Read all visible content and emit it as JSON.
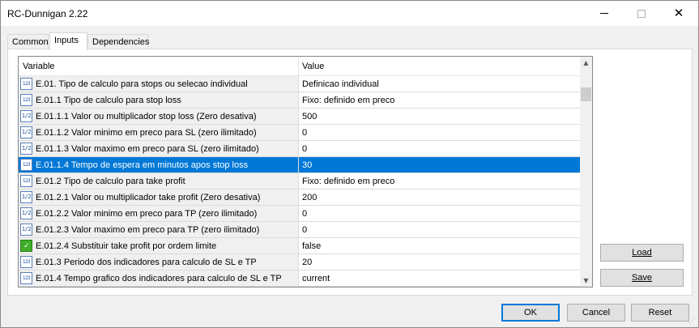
{
  "window": {
    "title": "RC-Dunnigan 2.22"
  },
  "tabs": [
    {
      "label": "Common"
    },
    {
      "label": "Inputs"
    },
    {
      "label": "Dependencies"
    }
  ],
  "grid": {
    "headers": {
      "variable": "Variable",
      "value": "Value"
    },
    "rows": [
      {
        "icon": "123",
        "label": "E.01. Tipo de calculo para stops ou selecao individual",
        "value": "Definicao individual"
      },
      {
        "icon": "123",
        "label": "E.01.1 Tipo de calculo para stop loss",
        "value": "Fixo: definido em preco"
      },
      {
        "icon": "1/2",
        "label": "E.01.1.1 Valor ou multiplicador stop loss (Zero desativa)",
        "value": "500"
      },
      {
        "icon": "1/2",
        "label": "E.01.1.2 Valor minimo em preco para SL (zero ilimitado)",
        "value": "0"
      },
      {
        "icon": "1/2",
        "label": "E.01.1.3 Valor maximo em preco para SL (zero ilimitado)",
        "value": "0"
      },
      {
        "icon": "123",
        "label": "E.01.1.4 Tempo de espera em minutos apos stop loss",
        "value": "30",
        "selected": true
      },
      {
        "icon": "123",
        "label": "E.01.2 Tipo de calculo para take profit",
        "value": "Fixo: definido em preco"
      },
      {
        "icon": "1/2",
        "label": "E.01.2.1 Valor ou multiplicador take profit (Zero desativa)",
        "value": "200"
      },
      {
        "icon": "1/2",
        "label": "E.01.2.2 Valor minimo em preco para TP (zero ilimitado)",
        "value": "0"
      },
      {
        "icon": "1/2",
        "label": "E.01.2.3 Valor maximo em preco para TP (zero ilimitado)",
        "value": "0"
      },
      {
        "icon": "bool",
        "label": "E.01.2.4 Substituir take profit por ordem limite",
        "value": "false"
      },
      {
        "icon": "123",
        "label": "E.01.3 Periodo dos indicadores para calculo de SL e TP",
        "value": "20"
      },
      {
        "icon": "123",
        "label": "E.01.4 Tempo grafico dos indicadores para calculo de SL e TP",
        "value": "current"
      }
    ]
  },
  "buttons": {
    "load": "Load",
    "save": "Save",
    "ok": "OK",
    "cancel": "Cancel",
    "reset": "Reset"
  },
  "colors": {
    "selection": "#0078d7",
    "button_face": "#e1e1e1"
  }
}
